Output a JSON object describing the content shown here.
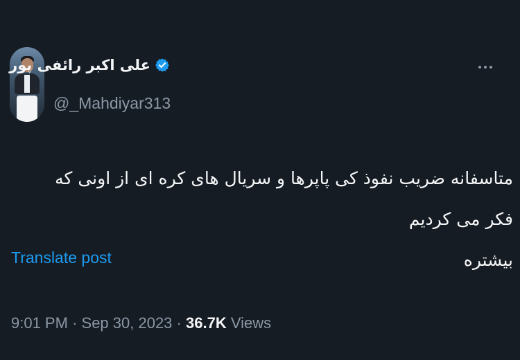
{
  "tweet": {
    "author": {
      "display_name": "علی اکبر رائفی پور",
      "handle": "@_Mahdiyar313",
      "verified": true,
      "avatar_icon": "profile-photo"
    },
    "more_icon": "more-options-icon",
    "text_lines": [
      "متاسفانه ضریب نفوذ کی پاپرها و سریال های کره ای از اونی که فکر می کردیم",
      "بیشتره"
    ],
    "translate_label": "Translate post",
    "time": "9:01 PM",
    "separator": "·",
    "date": "Sep 30, 2023",
    "views_count": "36.7K",
    "views_label": "Views"
  },
  "colors": {
    "background": "#161c24",
    "text": "#e7e9ea",
    "secondary": "#8b98a5",
    "accent": "#1d9bf0"
  }
}
